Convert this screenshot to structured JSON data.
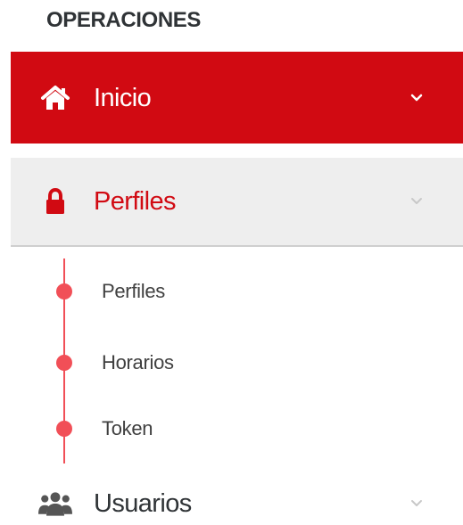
{
  "sidebar": {
    "section_title": "OPERACIONES",
    "items": [
      {
        "label": "Inicio",
        "icon": "home-icon",
        "state": "active",
        "chevron": "chevron-down-icon"
      },
      {
        "label": "Perfiles",
        "icon": "lock-icon",
        "state": "open",
        "chevron": "chevron-down-icon"
      },
      {
        "label": "Usuarios",
        "icon": "users-icon",
        "state": "collapsed",
        "chevron": "chevron-down-icon"
      }
    ],
    "submenu": {
      "items": [
        {
          "label": "Perfiles"
        },
        {
          "label": "Horarios"
        },
        {
          "label": "Token"
        }
      ]
    }
  },
  "colors": {
    "accent": "#d10a12",
    "submenu_marker": "#f14f57",
    "open_background": "#eeeeee",
    "text": "#2f3336"
  }
}
